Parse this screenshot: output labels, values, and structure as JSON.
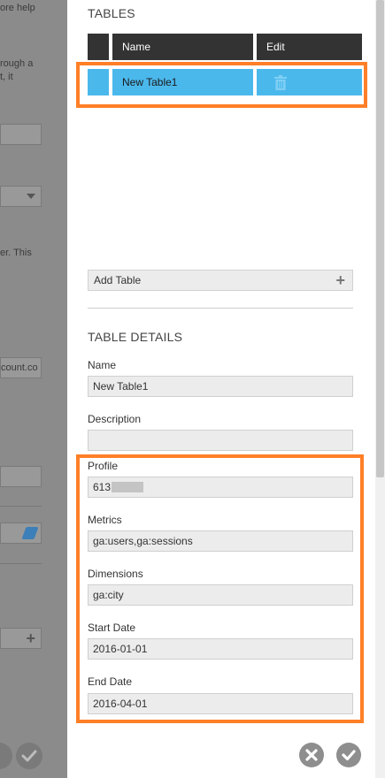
{
  "background": {
    "fragments": [
      "ore help",
      "rough a",
      "t, it",
      "er. This",
      "count.co"
    ]
  },
  "tables_section": {
    "title": "TABLES",
    "columns": {
      "name": "Name",
      "edit": "Edit"
    },
    "rows": [
      {
        "name": "New Table1",
        "edit_icon": "trash-icon"
      }
    ],
    "add_label": "Add Table"
  },
  "details_section": {
    "title": "TABLE DETAILS",
    "name": {
      "label": "Name",
      "value": "New Table1"
    },
    "description": {
      "label": "Description",
      "value": ""
    },
    "profile": {
      "label": "Profile",
      "value": "613"
    },
    "metrics": {
      "label": "Metrics",
      "value": "ga:users,ga:sessions"
    },
    "dimensions": {
      "label": "Dimensions",
      "value": "ga:city"
    },
    "start_date": {
      "label": "Start Date",
      "value": "2016-01-01"
    },
    "end_date": {
      "label": "End Date",
      "value": "2016-04-01"
    }
  },
  "colors": {
    "accent": "#ff7f27",
    "selected_row": "#4bb8ec",
    "header": "#333333"
  }
}
